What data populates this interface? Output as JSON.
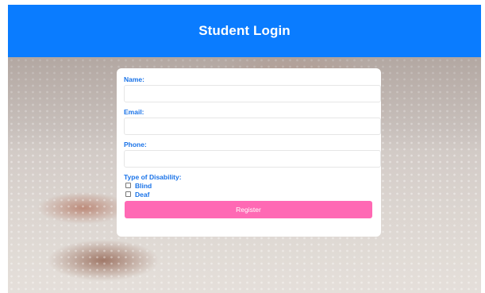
{
  "header": {
    "title": "Student Login"
  },
  "form": {
    "name": {
      "label": "Name:",
      "value": ""
    },
    "email": {
      "label": "Email:",
      "value": ""
    },
    "phone": {
      "label": "Phone:",
      "value": ""
    },
    "disability": {
      "label": "Type of Disability:",
      "options": [
        {
          "label": "Blind",
          "checked": false
        },
        {
          "label": "Deaf",
          "checked": false
        }
      ]
    },
    "register_label": "Register"
  },
  "colors": {
    "header": "#0a7cff",
    "label": "#1a73e8",
    "button": "#ff69b4"
  },
  "background": {
    "image": "hand-reading-braille-photo"
  }
}
